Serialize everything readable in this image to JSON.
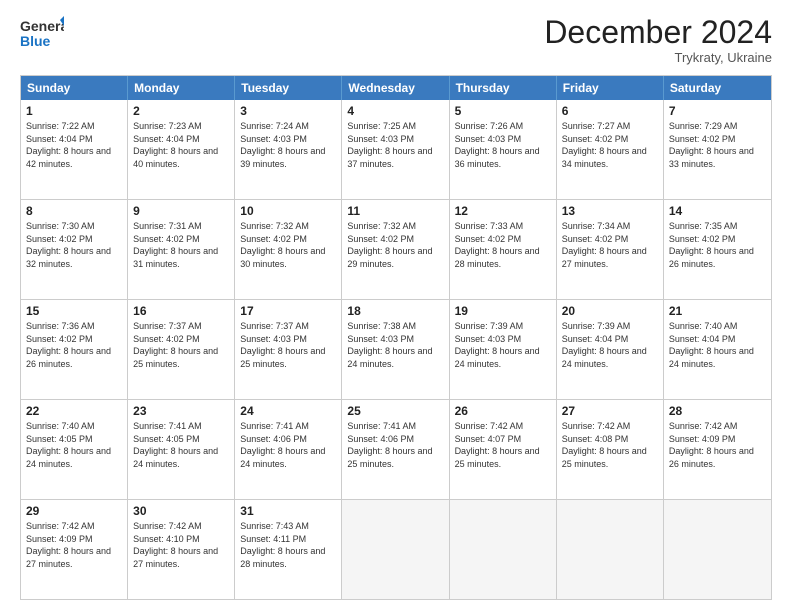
{
  "logo": {
    "line1": "General",
    "line2": "Blue"
  },
  "title": "December 2024",
  "subtitle": "Trykraty, Ukraine",
  "days": [
    "Sunday",
    "Monday",
    "Tuesday",
    "Wednesday",
    "Thursday",
    "Friday",
    "Saturday"
  ],
  "weeks": [
    [
      {
        "day": 1,
        "sunrise": "7:22 AM",
        "sunset": "4:04 PM",
        "daylight": "8 hours and 42 minutes."
      },
      {
        "day": 2,
        "sunrise": "7:23 AM",
        "sunset": "4:04 PM",
        "daylight": "8 hours and 40 minutes."
      },
      {
        "day": 3,
        "sunrise": "7:24 AM",
        "sunset": "4:03 PM",
        "daylight": "8 hours and 39 minutes."
      },
      {
        "day": 4,
        "sunrise": "7:25 AM",
        "sunset": "4:03 PM",
        "daylight": "8 hours and 37 minutes."
      },
      {
        "day": 5,
        "sunrise": "7:26 AM",
        "sunset": "4:03 PM",
        "daylight": "8 hours and 36 minutes."
      },
      {
        "day": 6,
        "sunrise": "7:27 AM",
        "sunset": "4:02 PM",
        "daylight": "8 hours and 34 minutes."
      },
      {
        "day": 7,
        "sunrise": "7:29 AM",
        "sunset": "4:02 PM",
        "daylight": "8 hours and 33 minutes."
      }
    ],
    [
      {
        "day": 8,
        "sunrise": "7:30 AM",
        "sunset": "4:02 PM",
        "daylight": "8 hours and 32 minutes."
      },
      {
        "day": 9,
        "sunrise": "7:31 AM",
        "sunset": "4:02 PM",
        "daylight": "8 hours and 31 minutes."
      },
      {
        "day": 10,
        "sunrise": "7:32 AM",
        "sunset": "4:02 PM",
        "daylight": "8 hours and 30 minutes."
      },
      {
        "day": 11,
        "sunrise": "7:32 AM",
        "sunset": "4:02 PM",
        "daylight": "8 hours and 29 minutes."
      },
      {
        "day": 12,
        "sunrise": "7:33 AM",
        "sunset": "4:02 PM",
        "daylight": "8 hours and 28 minutes."
      },
      {
        "day": 13,
        "sunrise": "7:34 AM",
        "sunset": "4:02 PM",
        "daylight": "8 hours and 27 minutes."
      },
      {
        "day": 14,
        "sunrise": "7:35 AM",
        "sunset": "4:02 PM",
        "daylight": "8 hours and 26 minutes."
      }
    ],
    [
      {
        "day": 15,
        "sunrise": "7:36 AM",
        "sunset": "4:02 PM",
        "daylight": "8 hours and 26 minutes."
      },
      {
        "day": 16,
        "sunrise": "7:37 AM",
        "sunset": "4:02 PM",
        "daylight": "8 hours and 25 minutes."
      },
      {
        "day": 17,
        "sunrise": "7:37 AM",
        "sunset": "4:03 PM",
        "daylight": "8 hours and 25 minutes."
      },
      {
        "day": 18,
        "sunrise": "7:38 AM",
        "sunset": "4:03 PM",
        "daylight": "8 hours and 24 minutes."
      },
      {
        "day": 19,
        "sunrise": "7:39 AM",
        "sunset": "4:03 PM",
        "daylight": "8 hours and 24 minutes."
      },
      {
        "day": 20,
        "sunrise": "7:39 AM",
        "sunset": "4:04 PM",
        "daylight": "8 hours and 24 minutes."
      },
      {
        "day": 21,
        "sunrise": "7:40 AM",
        "sunset": "4:04 PM",
        "daylight": "8 hours and 24 minutes."
      }
    ],
    [
      {
        "day": 22,
        "sunrise": "7:40 AM",
        "sunset": "4:05 PM",
        "daylight": "8 hours and 24 minutes."
      },
      {
        "day": 23,
        "sunrise": "7:41 AM",
        "sunset": "4:05 PM",
        "daylight": "8 hours and 24 minutes."
      },
      {
        "day": 24,
        "sunrise": "7:41 AM",
        "sunset": "4:06 PM",
        "daylight": "8 hours and 24 minutes."
      },
      {
        "day": 25,
        "sunrise": "7:41 AM",
        "sunset": "4:06 PM",
        "daylight": "8 hours and 25 minutes."
      },
      {
        "day": 26,
        "sunrise": "7:42 AM",
        "sunset": "4:07 PM",
        "daylight": "8 hours and 25 minutes."
      },
      {
        "day": 27,
        "sunrise": "7:42 AM",
        "sunset": "4:08 PM",
        "daylight": "8 hours and 25 minutes."
      },
      {
        "day": 28,
        "sunrise": "7:42 AM",
        "sunset": "4:09 PM",
        "daylight": "8 hours and 26 minutes."
      }
    ],
    [
      {
        "day": 29,
        "sunrise": "7:42 AM",
        "sunset": "4:09 PM",
        "daylight": "8 hours and 27 minutes."
      },
      {
        "day": 30,
        "sunrise": "7:42 AM",
        "sunset": "4:10 PM",
        "daylight": "8 hours and 27 minutes."
      },
      {
        "day": 31,
        "sunrise": "7:43 AM",
        "sunset": "4:11 PM",
        "daylight": "8 hours and 28 minutes."
      },
      null,
      null,
      null,
      null
    ]
  ]
}
